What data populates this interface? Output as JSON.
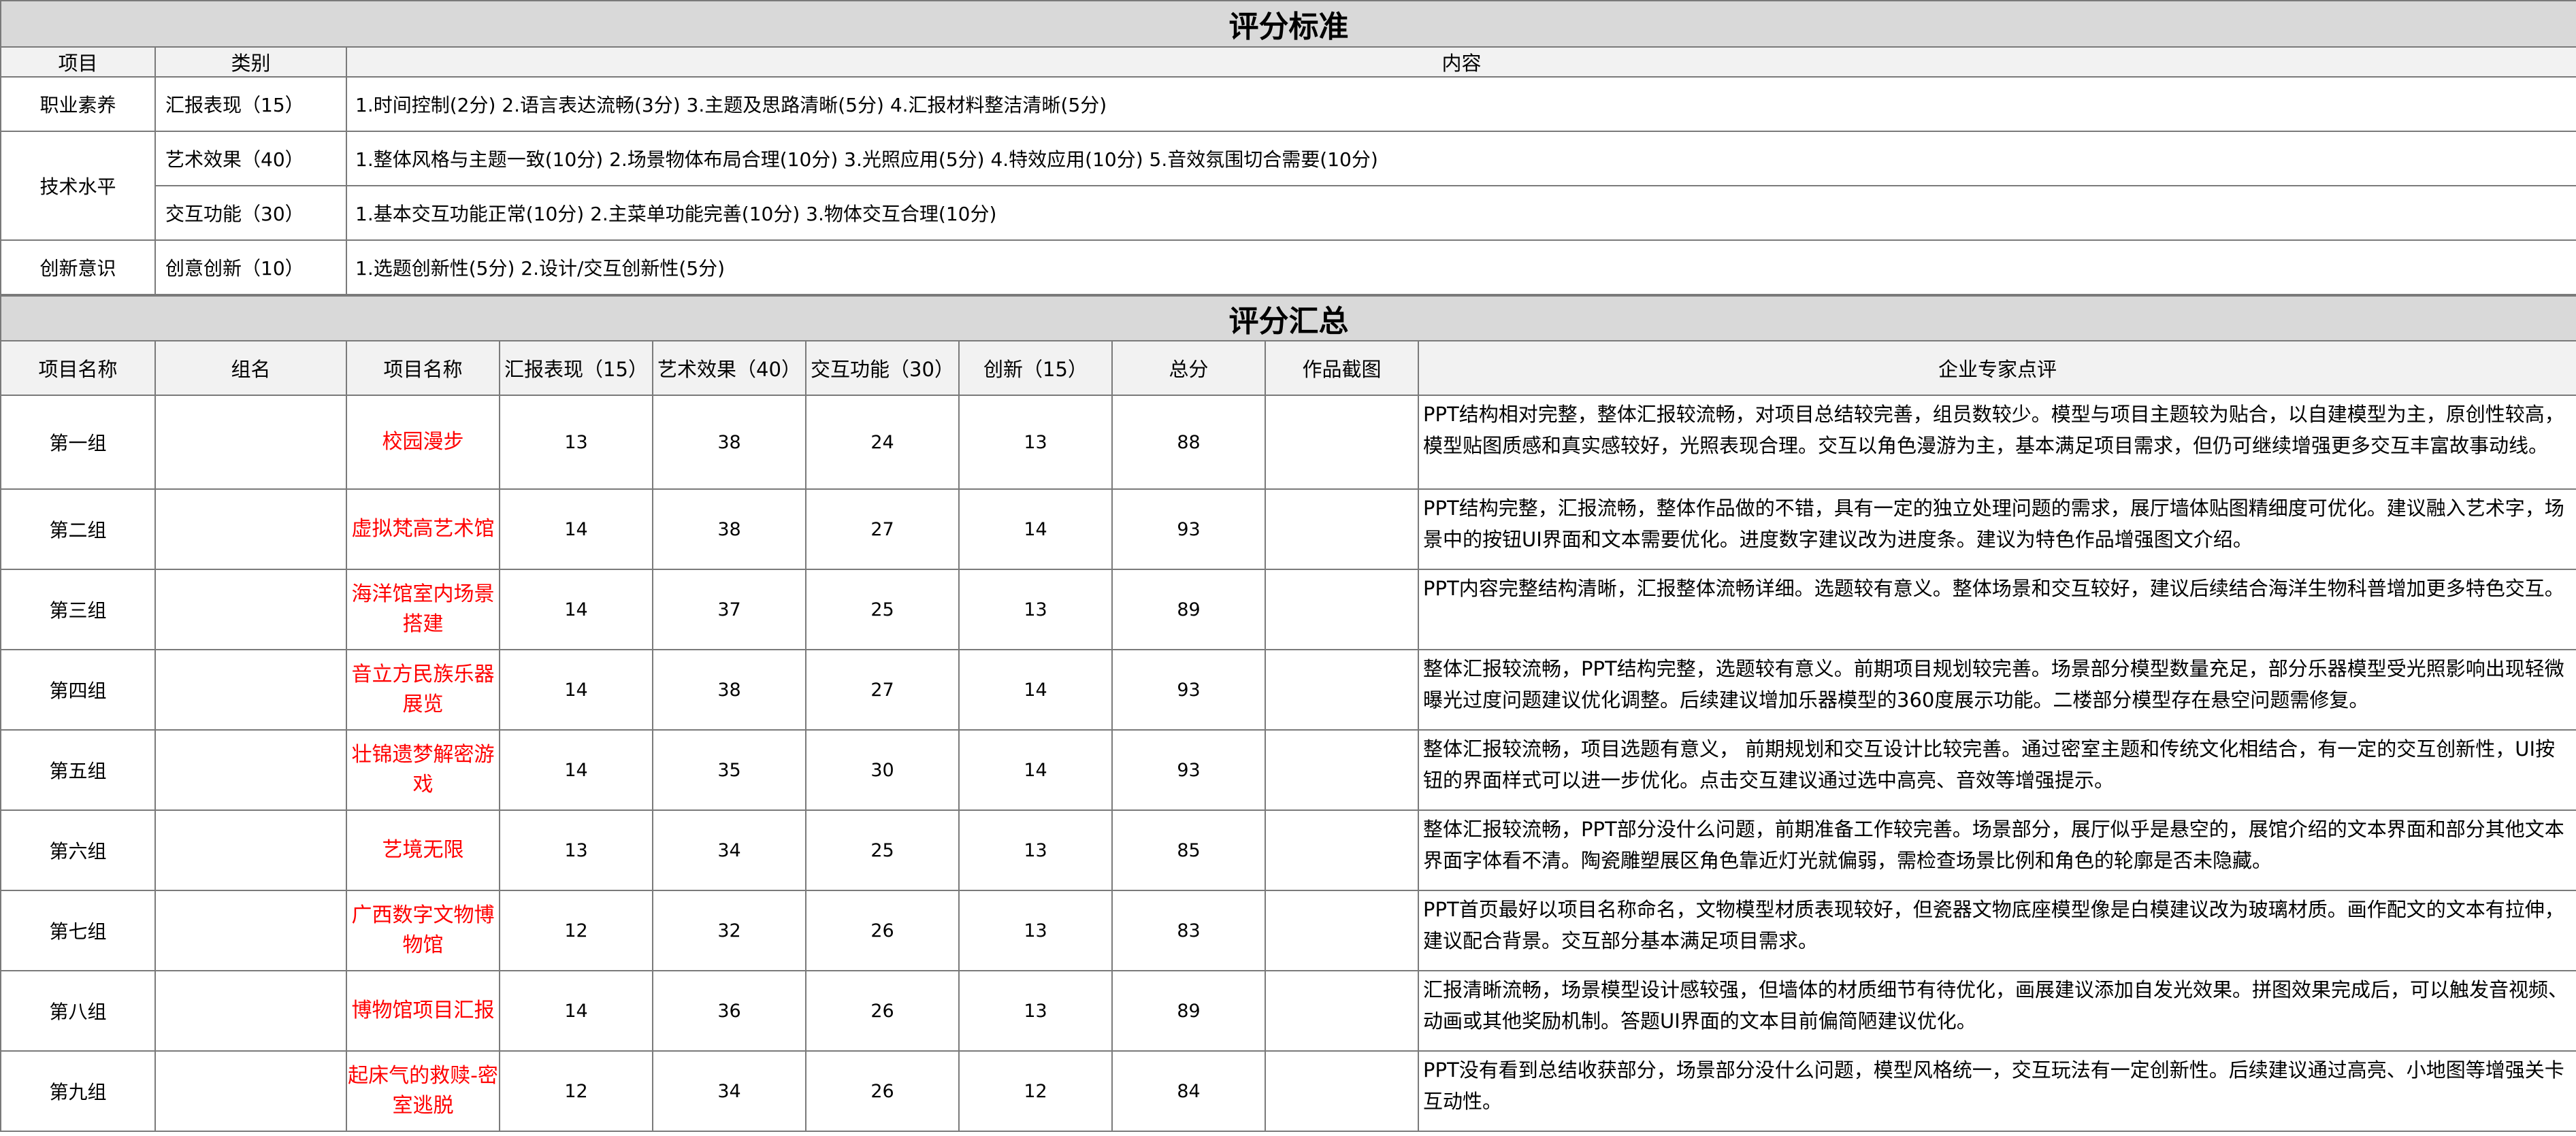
{
  "criteria": {
    "title": "评分标准",
    "headers": [
      "项目",
      "类别",
      "内容"
    ],
    "rows": [
      {
        "item": "职业素养",
        "category": "汇报表现（15）",
        "content": "1.时间控制(2分) 2.语言表达流畅(3分) 3.主题及思路清晰(5分) 4.汇报材料整洁清晰(5分)"
      },
      {
        "item": "技术水平",
        "category": "艺术效果（40）",
        "content": "1.整体风格与主题一致(10分) 2.场景物体布局合理(10分) 3.光照应用(5分) 4.特效应用(10分) 5.音效氛围切合需要(10分)"
      },
      {
        "item": "",
        "category": "交互功能（30）",
        "content": "1.基本交互功能正常(10分)  2.主菜单功能完善(10分)  3.物体交互合理(10分)"
      },
      {
        "item": "创新意识",
        "category": "创意创新（10）",
        "content": "1.选题创新性(5分)  2.设计/交互创新性(5分)"
      }
    ]
  },
  "summary": {
    "title": "评分汇总",
    "headers": [
      "项目名称",
      "组名",
      "项目名称",
      "汇报表现（15）",
      "艺术效果（40）",
      "交互功能（30）",
      "创新（15）",
      "总分",
      "作品截图",
      "企业专家点评"
    ],
    "rows": [
      {
        "group": "第一组",
        "team": "",
        "project": "校园漫步",
        "report": "13",
        "art": "38",
        "interact": "24",
        "innov": "13",
        "total": "88",
        "comment": "PPT结构相对完整，整体汇报较流畅，对项目总结较完善，组员数较少。模型与项目主题较为贴合，以自建模型为主，原创性较高，模型贴图质感和真实感较好，光照表现合理。交互以角色漫游为主，基本满足项目需求，但仍可继续增强更多交互丰富故事动线。"
      },
      {
        "group": "第二组",
        "team": "",
        "project": "虚拟梵高艺术馆",
        "report": "14",
        "art": "38",
        "interact": "27",
        "innov": "14",
        "total": "93",
        "comment": "PPT结构完整，汇报流畅，整体作品做的不错，具有一定的独立处理问题的需求，展厅墙体贴图精细度可优化。建议融入艺术字，场景中的按钮UI界面和文本需要优化。进度数字建议改为进度条。建议为特色作品增强图文介绍。"
      },
      {
        "group": "第三组",
        "team": "",
        "project": "海洋馆室内场景搭建",
        "report": "14",
        "art": "37",
        "interact": "25",
        "innov": "13",
        "total": "89",
        "comment": "PPT内容完整结构清晰，汇报整体流畅详细。选题较有意义。整体场景和交互较好，建议后续结合海洋生物科普增加更多特色交互。"
      },
      {
        "group": "第四组",
        "team": "",
        "project": "音立方民族乐器展览",
        "report": "14",
        "art": "38",
        "interact": "27",
        "innov": "14",
        "total": "93",
        "comment": "整体汇报较流畅，PPT结构完整，选题较有意义。前期项目规划较完善。场景部分模型数量充足，部分乐器模型受光照影响出现轻微曝光过度问题建议优化调整。后续建议增加乐器模型的360度展示功能。二楼部分模型存在悬空问题需修复。"
      },
      {
        "group": "第五组",
        "team": "",
        "project": "壮锦遗梦解密游戏",
        "report": "14",
        "art": "35",
        "interact": "30",
        "innov": "14",
        "total": "93",
        "comment": "整体汇报较流畅，项目选题有意义，  前期规划和交互设计比较完善。通过密室主题和传统文化相结合，有一定的交互创新性，UI按钮的界面样式可以进一步优化。点击交互建议通过选中高亮、音效等增强提示。"
      },
      {
        "group": "第六组",
        "team": "",
        "project": "艺境无限",
        "report": "13",
        "art": "34",
        "interact": "25",
        "innov": "13",
        "total": "85",
        "comment": "整体汇报较流畅，PPT部分没什么问题，前期准备工作较完善。场景部分，展厅似乎是悬空的，展馆介绍的文本界面和部分其他文本界面字体看不清。陶瓷雕塑展区角色靠近灯光就偏弱，需检查场景比例和角色的轮廓是否未隐藏。"
      },
      {
        "group": "第七组",
        "team": "",
        "project": "广西数字文物博物馆",
        "report": "12",
        "art": "32",
        "interact": "26",
        "innov": "13",
        "total": "83",
        "comment": "PPT首页最好以项目名称命名，文物模型材质表现较好，但瓷器文物底座模型像是白模建议改为玻璃材质。画作配文的文本有拉伸，建议配合背景。交互部分基本满足项目需求。"
      },
      {
        "group": "第八组",
        "team": "",
        "project": "博物馆项目汇报",
        "report": "14",
        "art": "36",
        "interact": "26",
        "innov": "13",
        "total": "89",
        "comment": "汇报清晰流畅，场景模型设计感较强，但墙体的材质细节有待优化，画展建议添加自发光效果。拼图效果完成后，可以触发音视频、动画或其他奖励机制。答题UI界面的文本目前偏简陋建议优化。"
      },
      {
        "group": "第九组",
        "team": "",
        "project": "起床气的救赎-密室逃脱",
        "report": "12",
        "art": "34",
        "interact": "26",
        "innov": "12",
        "total": "84",
        "comment": "PPT没有看到总结收获部分，场景部分没什么问题，模型风格统一，交互玩法有一定创新性。后续建议通过高亮、小地图等增强关卡互动性。"
      }
    ]
  },
  "colors": {
    "header_bg": "#d9d9d9",
    "subheader_bg": "#f2f2f2",
    "project_name": "#ff0000",
    "border": "#7a7a7a"
  }
}
